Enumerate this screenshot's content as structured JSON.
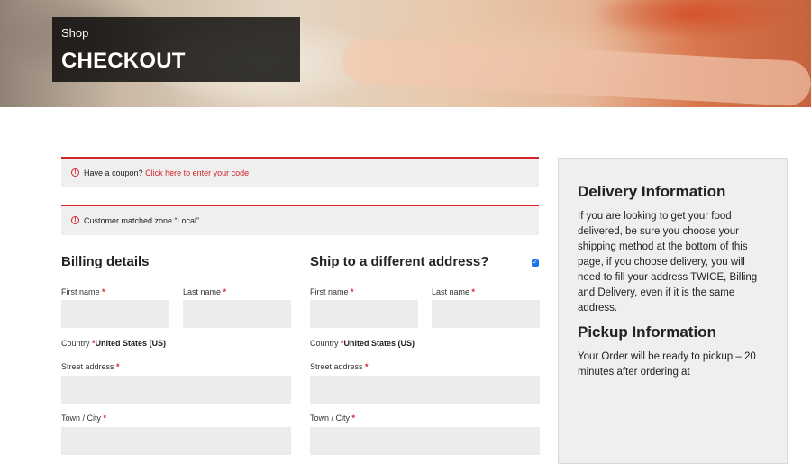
{
  "header": {
    "breadcrumb": "Shop",
    "title": "CHECKOUT"
  },
  "notices": {
    "coupon_text": "Have a coupon?",
    "coupon_link": "Click here to enter your code",
    "zone_text": "Customer matched zone “Local”"
  },
  "billing": {
    "heading": "Billing details",
    "first_name_label": "First name",
    "last_name_label": "Last name",
    "country_label": "Country",
    "country_value": "United States (US)",
    "street_label": "Street address",
    "town_label": "Town / City",
    "required_mark": "*"
  },
  "shipping": {
    "heading": "Ship to a different address?",
    "checked": true,
    "first_name_label": "First name",
    "last_name_label": "Last name",
    "country_label": "Country",
    "country_value": "United States (US)",
    "street_label": "Street address",
    "town_label": "Town / City",
    "required_mark": "*"
  },
  "sidebar": {
    "delivery_heading": "Delivery Information",
    "delivery_text": "If you are looking to get your food delivered, be sure you choose your shipping method at the bottom of this page, if you choose delivery, you will need to fill your address TWICE, Billing and Delivery, even if it is the same address.",
    "pickup_heading": "Pickup Information",
    "pickup_text": "Your Order will be ready to pickup – 20 minutes after ordering at"
  },
  "colors": {
    "accent": "#d3242b",
    "field_bg": "#ececec",
    "sidebar_bg": "#efefef"
  },
  "icons": {
    "notice": "info-circle-icon",
    "checkbox": "checkmark-icon"
  }
}
